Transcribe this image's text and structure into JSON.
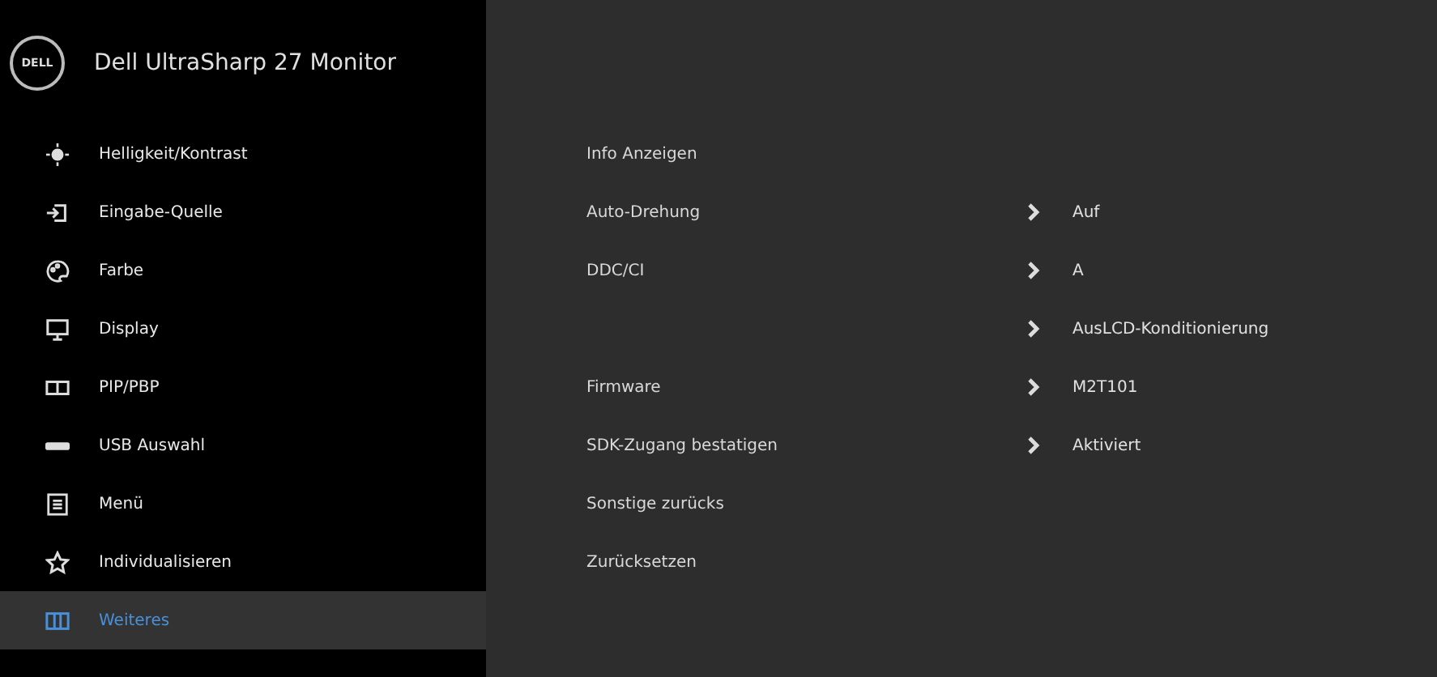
{
  "header": {
    "logo": "DELL",
    "title": "Dell UltraSharp 27 Monitor"
  },
  "sidebar": {
    "items": [
      {
        "label": "Helligkeit/Kontrast",
        "selected": false
      },
      {
        "label": "Eingabe-Quelle",
        "selected": false
      },
      {
        "label": "Farbe",
        "selected": false
      },
      {
        "label": "Display",
        "selected": false
      },
      {
        "label": "PIP/PBP",
        "selected": false
      },
      {
        "label": "USB Auswahl",
        "selected": false
      },
      {
        "label": "Menü",
        "selected": false
      },
      {
        "label": "Individualisieren",
        "selected": false
      },
      {
        "label": "Weiteres",
        "selected": true
      }
    ]
  },
  "settings": {
    "rows": [
      {
        "label": "Info Anzeigen"
      },
      {
        "label": "Auto-Drehung",
        "value": "Auf"
      },
      {
        "label": "DDC/CI",
        "value": "A"
      },
      {
        "value": "AusLCD-Konditionierung"
      },
      {
        "label": "Firmware",
        "value": "M2T101"
      },
      {
        "label": "SDK-Zugang bestatigen",
        "value": "Aktiviert"
      },
      {
        "label": "Sonstige zurücks"
      },
      {
        "label": "Zurücksetzen"
      }
    ]
  }
}
